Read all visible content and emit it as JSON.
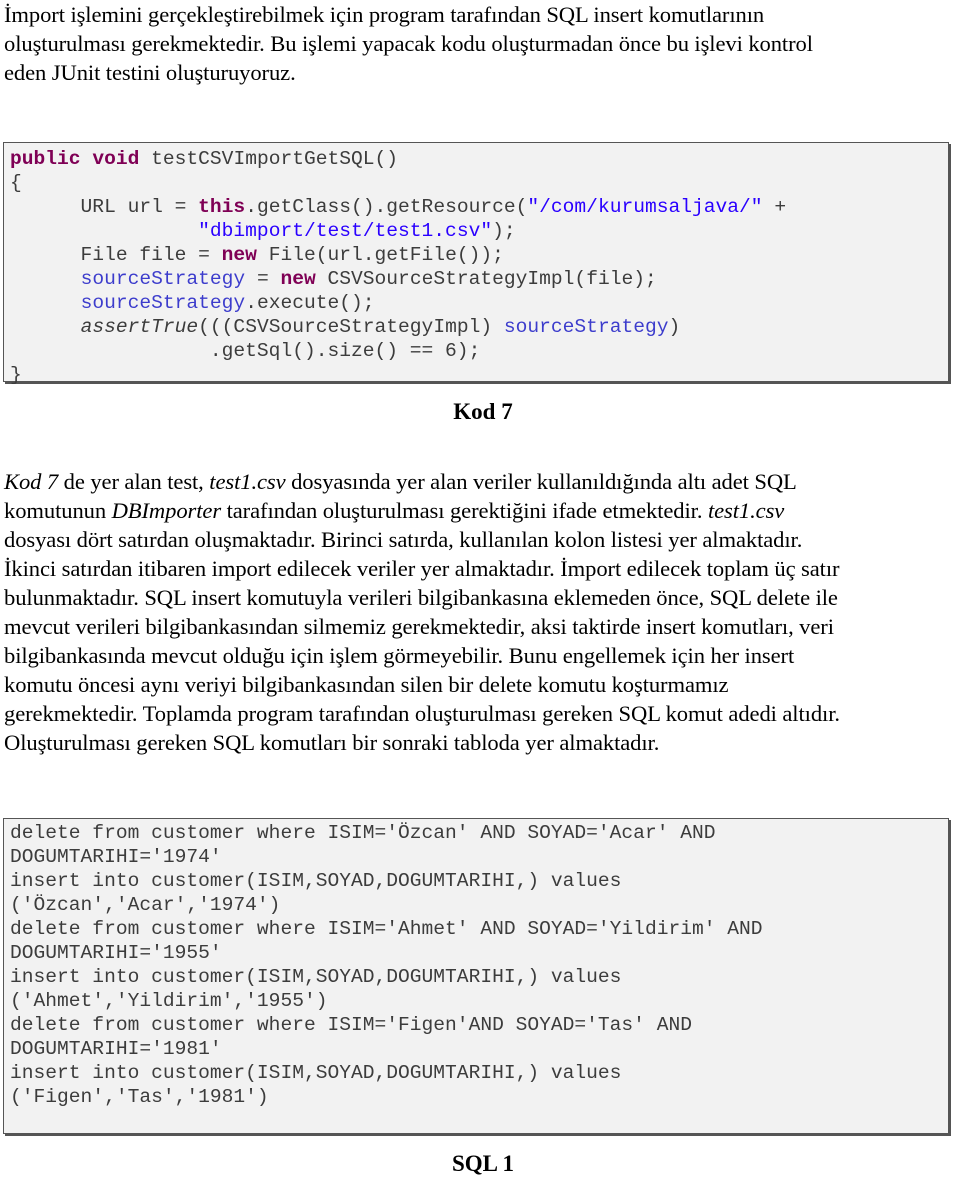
{
  "intro": {
    "lines": [
      "İmport işlemini gerçekleştirebilmek için program tarafından SQL insert komutlarının",
      "oluşturulması gerekmektedir. Bu işlemi yapacak kodu oluşturmadan önce bu işlevi kontrol",
      "eden JUnit testini oluşturuyoruz."
    ]
  },
  "java_code": {
    "lines": [
      [
        {
          "t": "kw",
          "v": "public"
        },
        {
          "t": "plain",
          "v": " "
        },
        {
          "t": "kw",
          "v": "void"
        },
        {
          "t": "plain",
          "v": " testCSVImportGetSQL()"
        }
      ],
      [
        {
          "t": "plain",
          "v": "{"
        }
      ],
      [
        {
          "t": "plain",
          "v": "      URL url = "
        },
        {
          "t": "kw",
          "v": "this"
        },
        {
          "t": "plain",
          "v": ".getClass().getResource("
        },
        {
          "t": "str",
          "v": "\"/com/kurumsaljava/\""
        },
        {
          "t": "plain",
          "v": " +"
        }
      ],
      [
        {
          "t": "plain",
          "v": "                "
        },
        {
          "t": "str",
          "v": "\"dbimport/test/test1.csv\""
        },
        {
          "t": "plain",
          "v": ");"
        }
      ],
      [
        {
          "t": "plain",
          "v": "      File file = "
        },
        {
          "t": "kw",
          "v": "new"
        },
        {
          "t": "plain",
          "v": " File(url.getFile());"
        }
      ],
      [
        {
          "t": "plain",
          "v": "      "
        },
        {
          "t": "fld",
          "v": "sourceStrategy"
        },
        {
          "t": "plain",
          "v": " = "
        },
        {
          "t": "kw",
          "v": "new"
        },
        {
          "t": "plain",
          "v": " CSVSourceStrategyImpl(file);"
        }
      ],
      [
        {
          "t": "plain",
          "v": "      "
        },
        {
          "t": "fld",
          "v": "sourceStrategy"
        },
        {
          "t": "plain",
          "v": ".execute();"
        }
      ],
      [
        {
          "t": "plain",
          "v": "      "
        },
        {
          "t": "ital",
          "v": "assertTrue"
        },
        {
          "t": "plain",
          "v": "(((CSVSourceStrategyImpl) "
        },
        {
          "t": "fld",
          "v": "sourceStrategy"
        },
        {
          "t": "plain",
          "v": ")"
        }
      ],
      [
        {
          "t": "plain",
          "v": "                 .getSql().size() == 6);"
        }
      ],
      [
        {
          "t": "plain",
          "v": "}"
        }
      ]
    ]
  },
  "captions": {
    "kod7": "Kod 7",
    "sql1": "SQL 1"
  },
  "body": {
    "lines": [
      [
        {
          "t": "it",
          "v": "Kod 7"
        },
        {
          "t": "n",
          "v": " de yer alan test, "
        },
        {
          "t": "it",
          "v": "test1.csv"
        },
        {
          "t": "n",
          "v": " dosyasında yer alan veriler kullanıldığında altı adet  SQL"
        }
      ],
      [
        {
          "t": "n",
          "v": "komutunun "
        },
        {
          "t": "it",
          "v": "DBImporter"
        },
        {
          "t": "n",
          "v": " tarafından oluşturulması gerektiğini ifade etmektedir. "
        },
        {
          "t": "it",
          "v": "test1.csv"
        }
      ],
      [
        {
          "t": "n",
          "v": "dosyası dört satırdan oluşmaktadır. Birinci satırda, kullanılan kolon listesi yer almaktadır."
        }
      ],
      [
        {
          "t": "n",
          "v": "İkinci satırdan itibaren import edilecek veriler yer almaktadır.  İmport edilecek toplam üç satır"
        }
      ],
      [
        {
          "t": "n",
          "v": "bulunmaktadır.  SQL insert komutuyla verileri bilgibankasına eklemeden önce, SQL delete ile"
        }
      ],
      [
        {
          "t": "n",
          "v": "mevcut verileri bilgibankasından silmemiz gerekmektedir, aksi taktirde insert komutları, veri"
        }
      ],
      [
        {
          "t": "n",
          "v": "bilgibankasında mevcut olduğu için işlem görmeyebilir. Bunu engellemek için her insert"
        }
      ],
      [
        {
          "t": "n",
          "v": "komutu öncesi aynı veriyi bilgibankasından silen bir delete komutu koşturmamız"
        }
      ],
      [
        {
          "t": "n",
          "v": "gerekmektedir. Toplamda program tarafından oluşturulması gereken SQL komut adedi altıdır."
        }
      ],
      [
        {
          "t": "n",
          "v": "Oluşturulması gereken SQL komutları bir sonraki tabloda yer almaktadır."
        }
      ]
    ]
  },
  "sql_code": {
    "lines": [
      "delete from customer where ISIM='Özcan' AND SOYAD='Acar' AND",
      "DOGUMTARIHI='1974'",
      "insert into customer(ISIM,SOYAD,DOGUMTARIHI,) values",
      "('Özcan','Acar','1974')",
      "delete from customer where ISIM='Ahmet' AND SOYAD='Yildirim' AND",
      "DOGUMTARIHI='1955'",
      "insert into customer(ISIM,SOYAD,DOGUMTARIHI,) values",
      "('Ahmet','Yildirim','1955')",
      "delete from customer where ISIM='Figen'AND SOYAD='Tas' AND",
      "DOGUMTARIHI='1981'",
      "insert into customer(ISIM,SOYAD,DOGUMTARIHI,) values",
      "('Figen','Tas','1981')"
    ]
  },
  "colors": {
    "keyword": "#7f0055",
    "string": "#2a00ff",
    "field": "#0000c0",
    "code_background": "#f2f2f2",
    "code_border": "#555555"
  }
}
